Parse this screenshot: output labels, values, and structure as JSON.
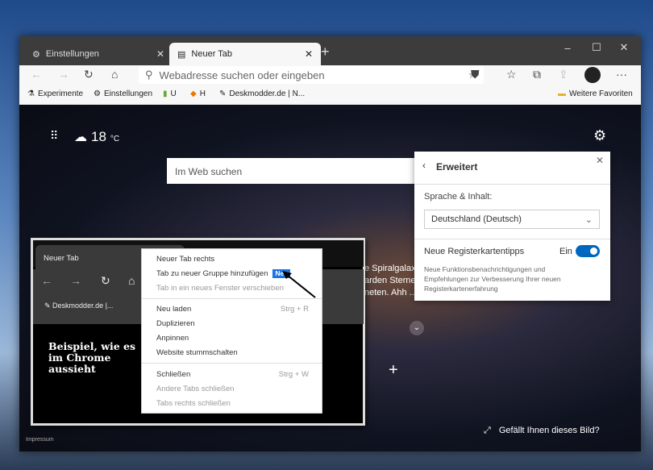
{
  "window": {
    "tabs": [
      {
        "label": "Einstellungen",
        "icon": "gear-icon"
      },
      {
        "label": "Neuer Tab",
        "icon": "newtab-icon",
        "active": true
      }
    ],
    "new_tab": "+",
    "controls": {
      "minimize": "–",
      "maximize": "☐",
      "close": "✕"
    },
    "address_placeholder": "Webadresse suchen oder eingeben",
    "more": "···"
  },
  "favorites": {
    "items": [
      "Experimente",
      "Einstellungen",
      "U",
      "H",
      "Deskmodder.de | N..."
    ],
    "other": "Weitere Favoriten"
  },
  "newtab": {
    "temperature": "18",
    "unit": "°C",
    "search_placeholder": "Im Web suchen",
    "caption_lines": [
      "e Spiralgalaxi",
      "arden Sterner",
      "neten. Ahh ..."
    ],
    "like_image": "Gefällt Ihnen dieses Bild?",
    "imprint": "Impressum"
  },
  "panel": {
    "title": "Erweitert",
    "language_label": "Sprache & Inhalt:",
    "language_value": "Deutschland (Deutsch)",
    "tips_label": "Neue Registerkartentipps",
    "tips_state": "Ein",
    "tips_enabled": true,
    "tips_desc": "Neue Funktionsbenachrichtigungen und Empfehlungen zur Verbesserung Ihrer neuen Registerkartenerfahrung",
    "accent": "#0067c0"
  },
  "chrome_example": {
    "tab": "Neuer Tab",
    "bookmark": "Deskmodder.de |...",
    "caption": "Beispiel, wie es im Chrome aussieht",
    "menu": [
      {
        "label": "Neuer Tab rechts"
      },
      {
        "label": "Tab zu neuer Gruppe hinzufügen",
        "badge": "Neu"
      },
      {
        "label": "Tab in ein neues Fenster verschieben",
        "disabled": true
      },
      {
        "label": "Neu laden",
        "shortcut": "Strg + R"
      },
      {
        "label": "Duplizieren"
      },
      {
        "label": "Anpinnen"
      },
      {
        "label": "Website stummschalten"
      },
      {
        "label": "Schließen",
        "shortcut": "Strg + W"
      },
      {
        "label": "Andere Tabs schließen",
        "disabled": true
      },
      {
        "label": "Tabs rechts schließen",
        "disabled": true
      }
    ]
  }
}
